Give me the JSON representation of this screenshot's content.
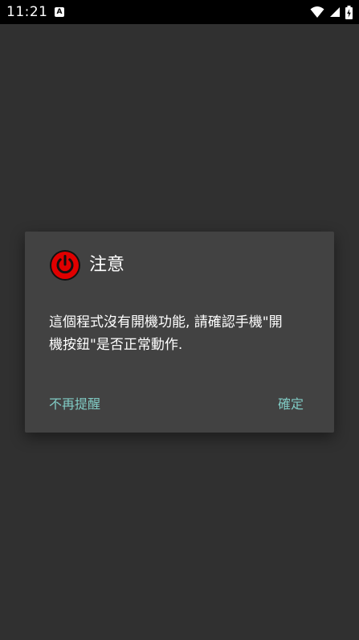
{
  "status_bar": {
    "time": "11:21",
    "notification_icon": "A",
    "icons": [
      "wifi-icon",
      "signal-icon",
      "battery-charging-icon"
    ]
  },
  "dialog": {
    "icon": "power-icon",
    "title": "注意",
    "message": "這個程式沒有開機功能, 請確認手機\"開機按鈕\"是否正常動作.",
    "neutral_button": "不再提醒",
    "positive_button": "確定"
  },
  "colors": {
    "background": "#303030",
    "dialog_surface": "#424242",
    "accent": "#80cbc4",
    "power_icon_red": "#e00000"
  }
}
